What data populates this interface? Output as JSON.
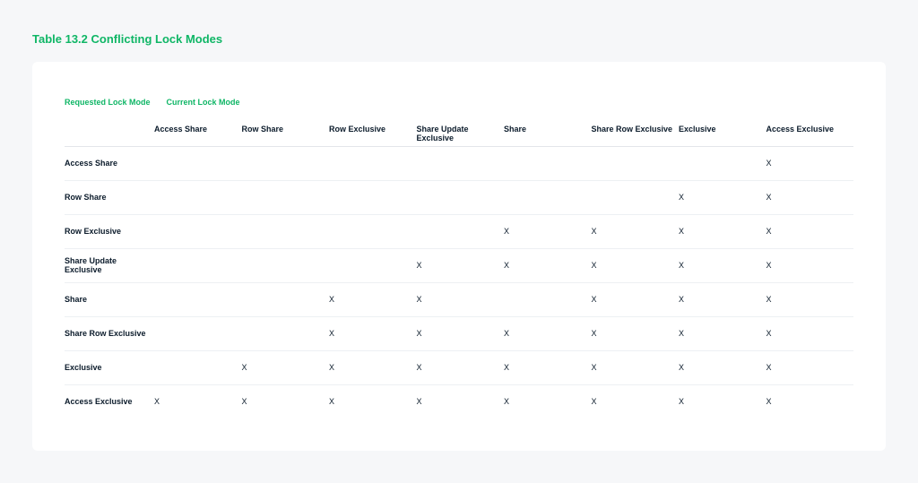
{
  "title": "Table 13.2 Conflicting Lock Modes",
  "legend": {
    "row": "Requested Lock Mode",
    "col": "Current Lock Mode"
  },
  "columns": [
    "Access Share",
    "Row Share",
    "Row Exclusive",
    "Share Update Exclusive",
    "Share",
    "Share Row Exclusive",
    "Exclusive",
    "Access Exclusive"
  ],
  "rows": [
    {
      "label": "Access Share",
      "conflicts": [
        "",
        "",
        "",
        "",
        "",
        "",
        "",
        "X"
      ]
    },
    {
      "label": "Row Share",
      "conflicts": [
        "",
        "",
        "",
        "",
        "",
        "",
        "X",
        "X"
      ]
    },
    {
      "label": "Row Exclusive",
      "conflicts": [
        "",
        "",
        "",
        "",
        "X",
        "X",
        "X",
        "X"
      ]
    },
    {
      "label": "Share Update Exclusive",
      "conflicts": [
        "",
        "",
        "",
        "X",
        "X",
        "X",
        "X",
        "X"
      ]
    },
    {
      "label": "Share",
      "conflicts": [
        "",
        "",
        "X",
        "X",
        "",
        "X",
        "X",
        "X"
      ]
    },
    {
      "label": "Share Row Exclusive",
      "conflicts": [
        "",
        "",
        "X",
        "X",
        "X",
        "X",
        "X",
        "X"
      ]
    },
    {
      "label": "Exclusive",
      "conflicts": [
        "",
        "X",
        "X",
        "X",
        "X",
        "X",
        "X",
        "X"
      ]
    },
    {
      "label": "Access Exclusive",
      "conflicts": [
        "X",
        "X",
        "X",
        "X",
        "X",
        "X",
        "X",
        "X"
      ]
    }
  ]
}
